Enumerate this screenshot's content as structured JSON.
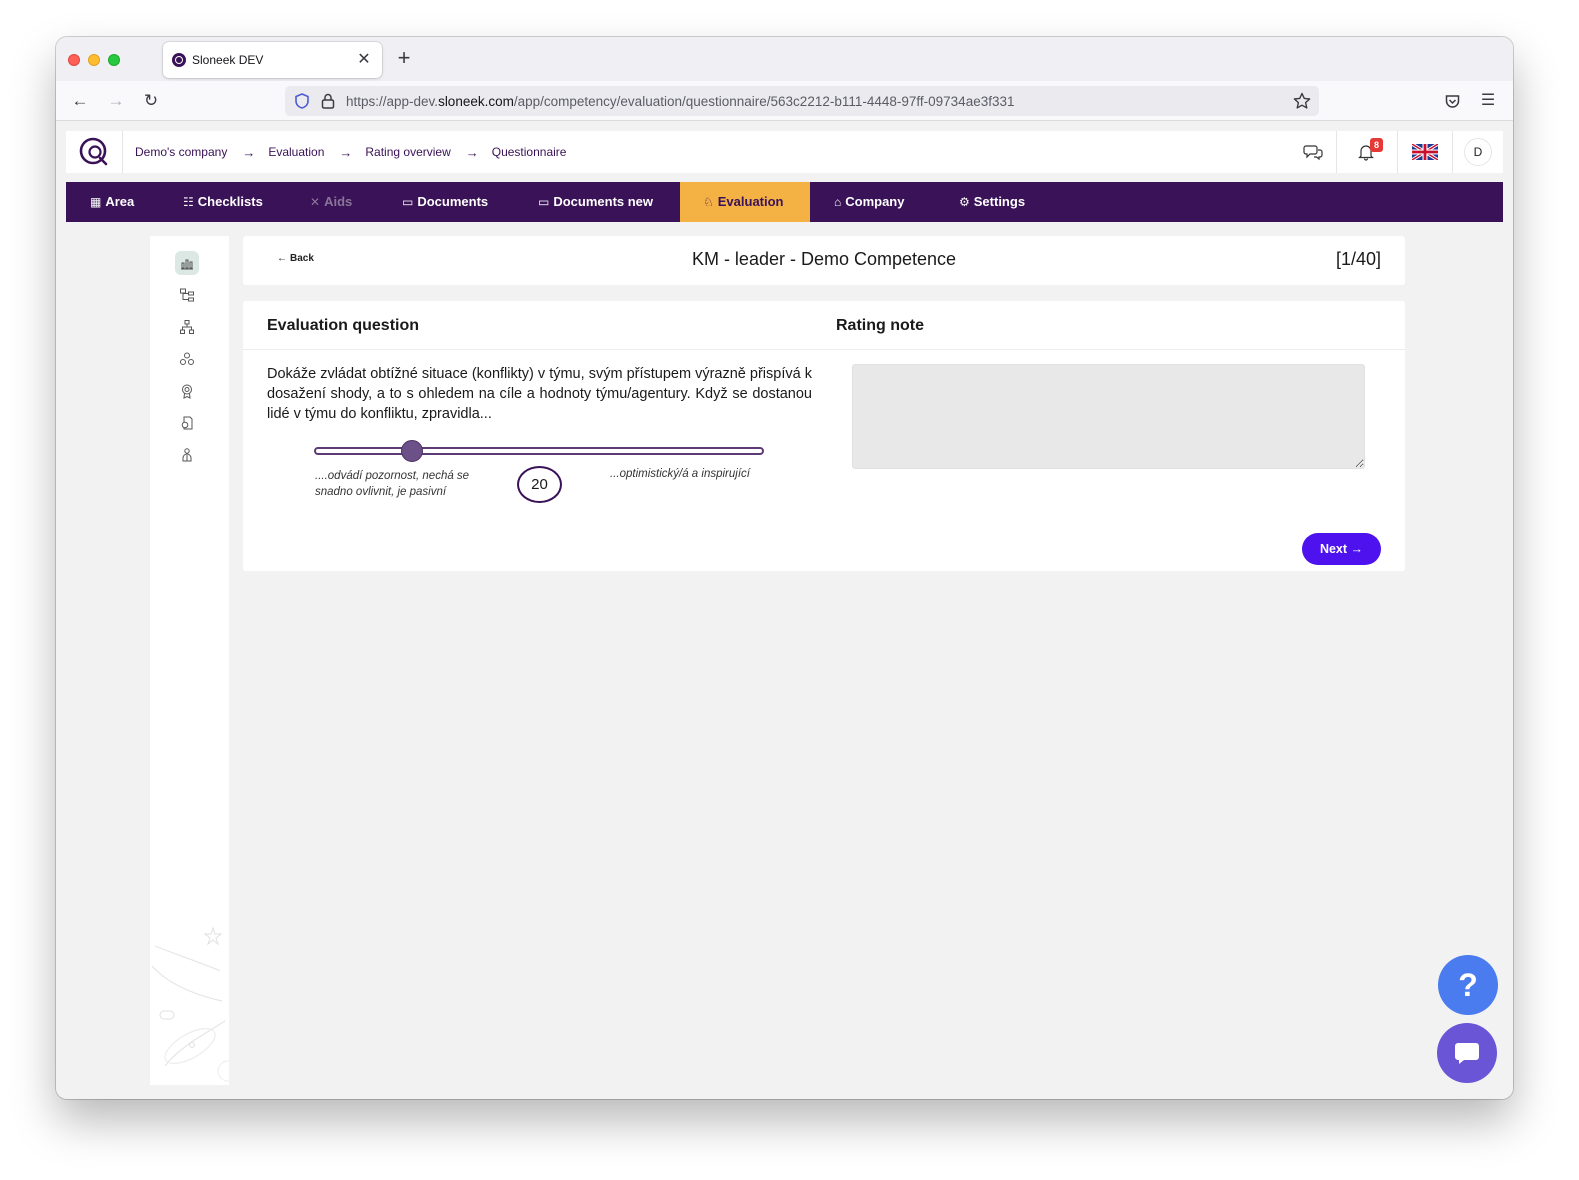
{
  "browser": {
    "tab_title": "Sloneek DEV",
    "url_prefix": "https://app-dev.",
    "url_domain": "sloneek.com",
    "url_path": "/app/competency/evaluation/questionnaire/563c2212-b111-4448-97ff-09734ae3f331"
  },
  "breadcrumbs": [
    "Demo's company",
    "Evaluation",
    "Rating overview",
    "Questionnaire"
  ],
  "breadcrumb_separator": "→",
  "notifications": {
    "count": "8"
  },
  "user": {
    "initial": "D"
  },
  "main_nav": [
    {
      "label": "Area",
      "icon": "grid-icon"
    },
    {
      "label": "Checklists",
      "icon": "checklist-icon"
    },
    {
      "label": "Aids",
      "icon": "tools-icon",
      "disabled": true
    },
    {
      "label": "Documents",
      "icon": "folder-icon"
    },
    {
      "label": "Documents new",
      "icon": "folder-icon"
    },
    {
      "label": "Evaluation",
      "icon": "evaluation-icon",
      "active": true
    },
    {
      "label": "Company",
      "icon": "bank-icon"
    },
    {
      "label": "Settings",
      "icon": "gear-icon"
    }
  ],
  "questionnaire": {
    "back_label": "Back",
    "title": "KM - leader - Demo Competence",
    "progress": "[1/40]",
    "col_question": "Evaluation question",
    "col_note": "Rating note",
    "question_text": "Dokáže zvládat obtížné situace (konflikty) v týmu, svým přístupem výrazně přispívá k dosažení shody, a to s ohledem na cíle a hodnoty týmu/agentury. Když se dostanou lidé v týmu do konfliktu, zpravidla...",
    "slider": {
      "value": "20",
      "min_label": "....odvádí pozornost, nechá se snadno ovlivnit, je pasivní",
      "max_label": "...optimistický/á a inspirující"
    },
    "note_value": "",
    "next_label": "Next →"
  },
  "help": {
    "label": "?"
  },
  "colors": {
    "brand": "#3a1257",
    "accent": "#f5b244",
    "primary_button": "#4d12ee"
  }
}
